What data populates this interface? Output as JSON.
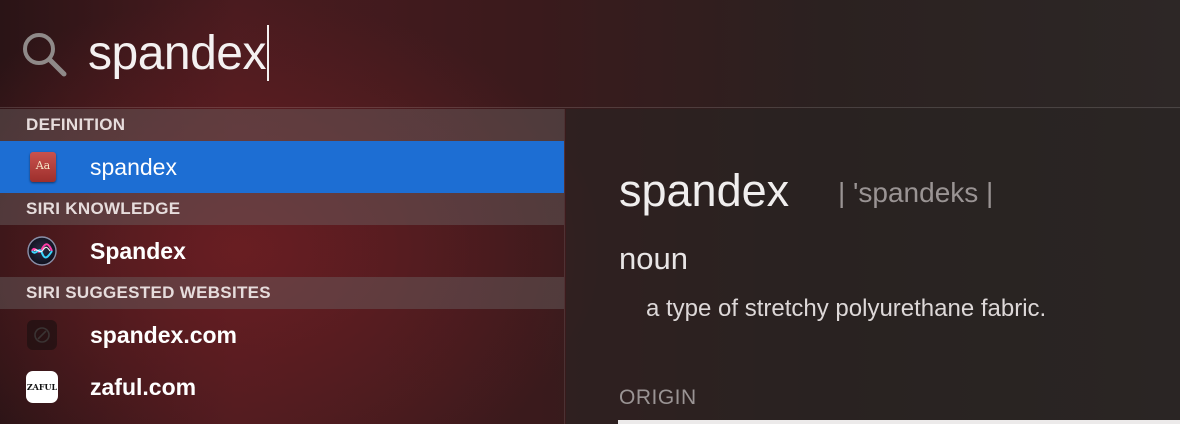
{
  "search": {
    "query": "spandex"
  },
  "sections": [
    {
      "header": "DEFINITION",
      "items": [
        {
          "label": "spandex",
          "icon": "dictionary-icon",
          "icon_text": "Aa",
          "selected": true
        }
      ]
    },
    {
      "header": "SIRI KNOWLEDGE",
      "items": [
        {
          "label": "Spandex",
          "icon": "siri-icon"
        }
      ]
    },
    {
      "header": "SIRI SUGGESTED WEBSITES",
      "items": [
        {
          "label": "spandex.com",
          "icon": "website-icon"
        },
        {
          "label": "zaful.com",
          "icon": "zaful-icon",
          "icon_text": "ZAFUL"
        }
      ]
    }
  ],
  "preview": {
    "word": "spandex",
    "pronunciation": "| 'spandeks |",
    "part_of_speech": "noun",
    "definition": "a type of stretchy polyurethane fabric.",
    "origin_label": "ORIGIN"
  },
  "colors": {
    "selection": "#1d6ed3",
    "text": "#ffffff",
    "muted": "#9a9494"
  }
}
